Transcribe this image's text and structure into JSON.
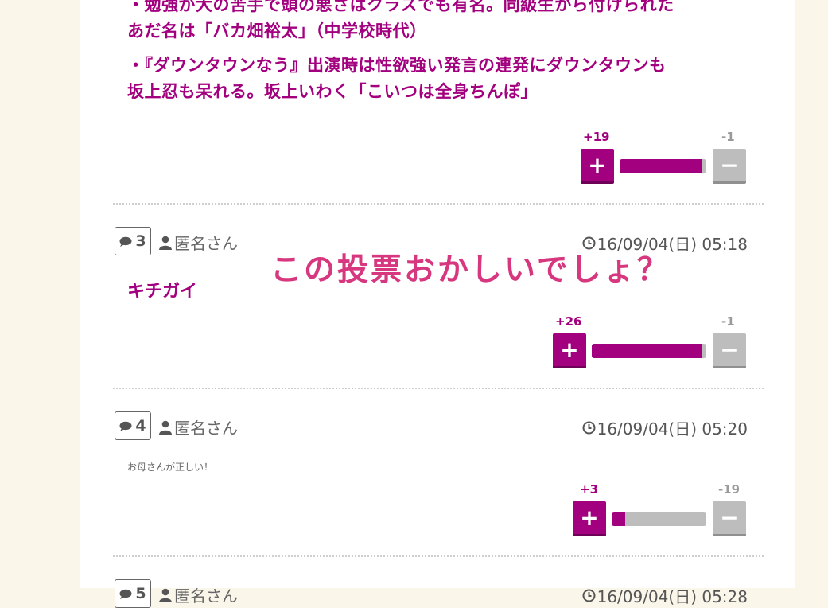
{
  "colors": {
    "accent": "#a3007f",
    "overlay": "#d6377e",
    "neutral": "#bdbdbd"
  },
  "post2": {
    "lines": [
      "・勉強が大の苦手で頭の悪さはクラスでも有名。同級生から付けられた",
      "あだ名は「バカ畑裕太」（中学校時代）",
      "・『ダウンタウンなう』出演時は性欲強い発言の連発にダウンタウンも",
      "坂上忍も呆れる。坂上いわく「こいつは全身ちんぽ」"
    ],
    "votes": {
      "up": "+19",
      "down": "-1",
      "up_ratio": 0.95
    }
  },
  "comments": [
    {
      "number": "3",
      "user": "匿名さん",
      "date": "16/09/04(日) 05:18",
      "text": "キチガイ",
      "votes": {
        "up": "+26",
        "down": "-1",
        "up_ratio": 0.96
      }
    },
    {
      "number": "4",
      "user": "匿名さん",
      "date": "16/09/04(日) 05:20",
      "text": "お母さんが正しい！",
      "votes": {
        "up": "+3",
        "down": "-19",
        "up_ratio": 0.14
      }
    },
    {
      "number": "5",
      "user": "匿名さん",
      "date": "16/09/04(日) 05:28"
    }
  ],
  "overlay_caption": "この投票おかしいでしょ？",
  "icons": {
    "comment": "speech-bubble-icon",
    "user": "user-icon",
    "clock": "clock-icon",
    "plus": "+",
    "minus": "−"
  }
}
